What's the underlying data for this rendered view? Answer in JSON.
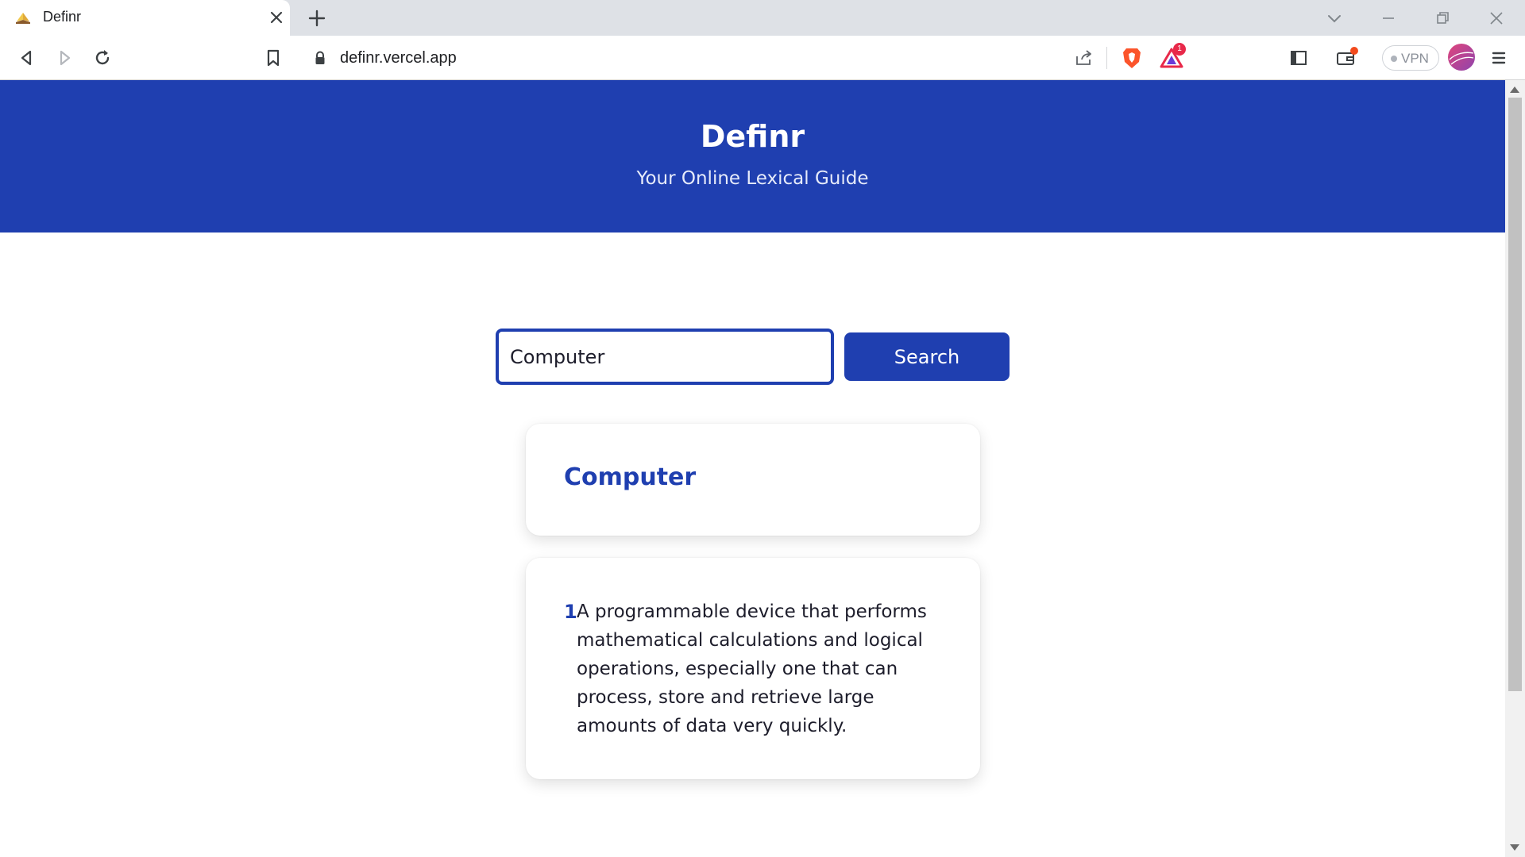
{
  "browser": {
    "tab_title": "Definr",
    "url": "definr.vercel.app",
    "vpn_label": "VPN",
    "rewards_badge": "1"
  },
  "header": {
    "title": "Definr",
    "subtitle": "Your Online Lexical Guide"
  },
  "search": {
    "value": "Computer",
    "button_label": "Search"
  },
  "result": {
    "word": "Computer",
    "definitions": [
      {
        "number": "1",
        "text": "A programmable device that performs mathematical calculations and logical operations, especially one that can process, store and retrieve large amounts of data very quickly."
      }
    ]
  },
  "colors": {
    "brand_blue": "#1f3fb0",
    "text_dark": "#1d1d2b"
  }
}
